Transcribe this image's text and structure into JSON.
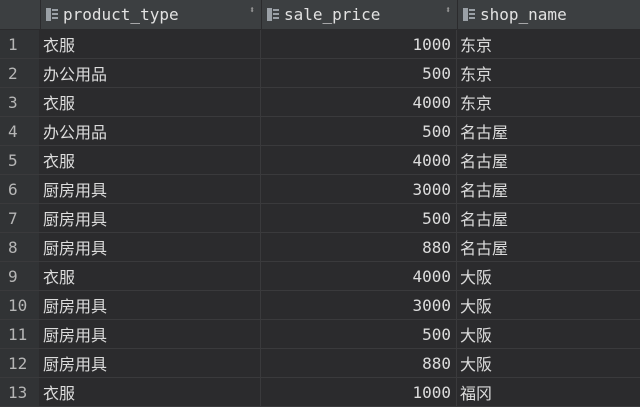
{
  "columns": [
    {
      "label": "product_type",
      "icon": "column-icon",
      "sort_icon": "sort-icon"
    },
    {
      "label": "sale_price",
      "icon": "column-icon",
      "sort_icon": "sort-icon"
    },
    {
      "label": "shop_name",
      "icon": "column-icon"
    }
  ],
  "sort_glyph": "⬍",
  "rows": [
    {
      "num": "1",
      "product_type": "衣服",
      "sale_price": "1000",
      "shop_name": "东京"
    },
    {
      "num": "2",
      "product_type": "办公用品",
      "sale_price": "500",
      "shop_name": "东京"
    },
    {
      "num": "3",
      "product_type": "衣服",
      "sale_price": "4000",
      "shop_name": "东京"
    },
    {
      "num": "4",
      "product_type": "办公用品",
      "sale_price": "500",
      "shop_name": "名古屋"
    },
    {
      "num": "5",
      "product_type": "衣服",
      "sale_price": "4000",
      "shop_name": "名古屋"
    },
    {
      "num": "6",
      "product_type": "厨房用具",
      "sale_price": "3000",
      "shop_name": "名古屋"
    },
    {
      "num": "7",
      "product_type": "厨房用具",
      "sale_price": "500",
      "shop_name": "名古屋"
    },
    {
      "num": "8",
      "product_type": "厨房用具",
      "sale_price": "880",
      "shop_name": "名古屋"
    },
    {
      "num": "9",
      "product_type": "衣服",
      "sale_price": "4000",
      "shop_name": "大阪"
    },
    {
      "num": "10",
      "product_type": "厨房用具",
      "sale_price": "3000",
      "shop_name": "大阪"
    },
    {
      "num": "11",
      "product_type": "厨房用具",
      "sale_price": "500",
      "shop_name": "大阪"
    },
    {
      "num": "12",
      "product_type": "厨房用具",
      "sale_price": "880",
      "shop_name": "大阪"
    },
    {
      "num": "13",
      "product_type": "衣服",
      "sale_price": "1000",
      "shop_name": "福冈"
    }
  ]
}
